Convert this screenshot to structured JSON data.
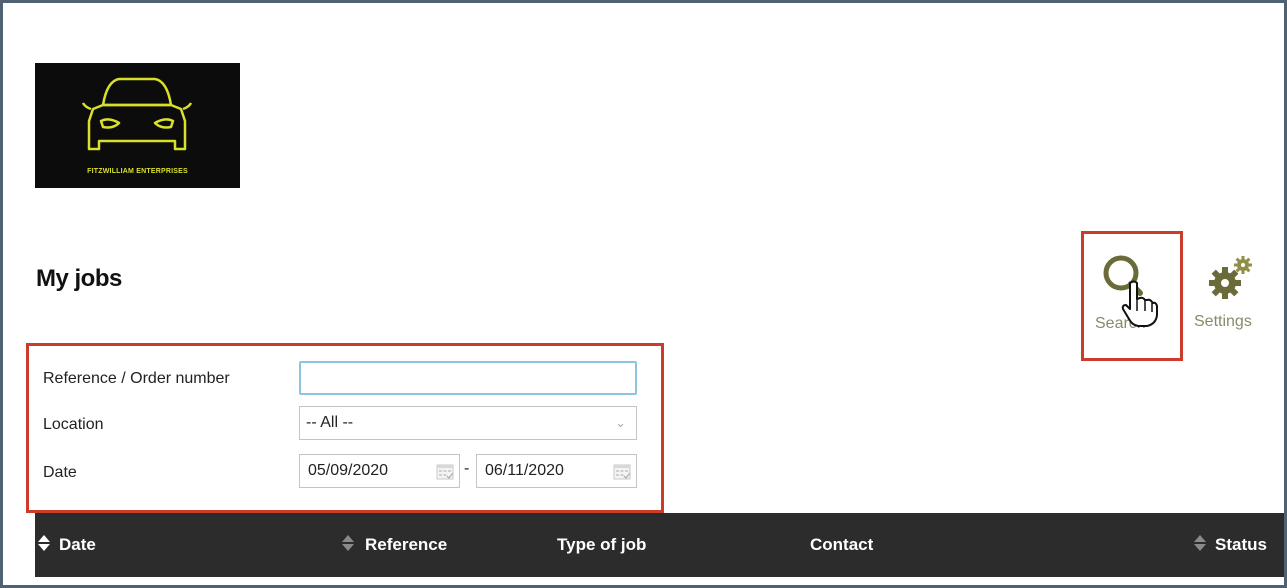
{
  "logo": {
    "text": "FITZWILLIAM ENTERPRISES"
  },
  "page": {
    "title": "My jobs"
  },
  "toolbar": {
    "search_label": "Search",
    "settings_label": "Settings"
  },
  "filters": {
    "reference_label": "Reference / Order number",
    "reference_value": "",
    "location_label": "Location",
    "location_value": "-- All --",
    "date_label": "Date",
    "date_from": "05/09/2020",
    "date_separator": "-",
    "date_to": "06/11/2020"
  },
  "table": {
    "columns": [
      "Date",
      "Reference",
      "Type of job",
      "Contact",
      "Status"
    ]
  },
  "colors": {
    "highlight": "#cd3b2a",
    "header_bg": "#2c2c2c",
    "logo_accent": "#d8e02a",
    "icon_olive": "#6b6b3a"
  }
}
